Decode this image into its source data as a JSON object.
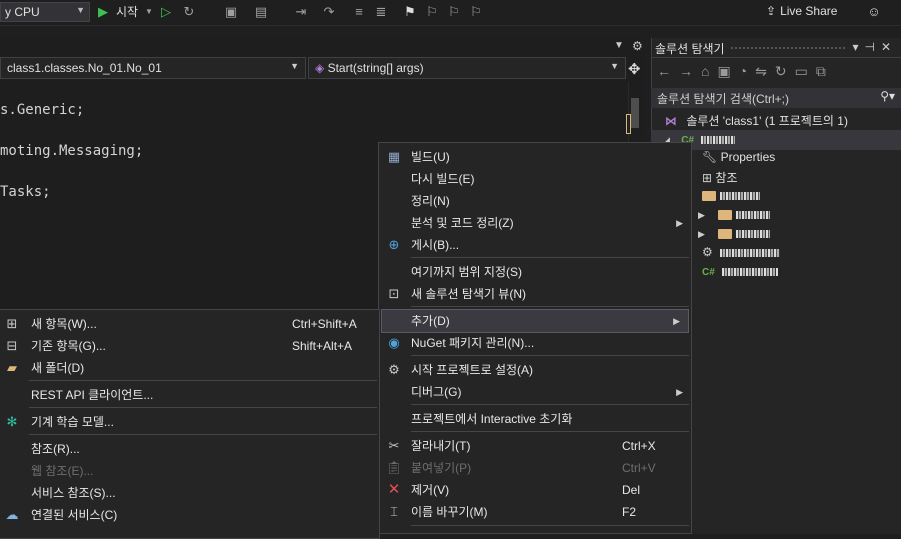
{
  "toolbar": {
    "platform": "y CPU",
    "start_label": "시작",
    "live_share_label": "Live Share"
  },
  "editor": {
    "nav_class": "class1.classes.No_01.No_01",
    "nav_member": "Start(string[] args)",
    "code_lines": [
      "s.Generic;",
      "moting.Messaging;",
      "Tasks;"
    ]
  },
  "solution_explorer": {
    "title": "솔루션 탐색기",
    "search_placeholder": "솔루션 탐색기 검색(Ctrl+;)",
    "solution_label": "솔루션 'class1' (1 프로젝트의 1)",
    "project_label": "class1",
    "items": [
      {
        "label": "Properties",
        "icon": "wrench-icon"
      },
      {
        "label": "참조",
        "icon": "references-icon"
      }
    ],
    "folder_labels": [
      "No_01",
      "No_02"
    ]
  },
  "project_menu": {
    "items": [
      {
        "label": "빌드(U)",
        "icon": "build-icon"
      },
      {
        "label": "다시 빌드(E)"
      },
      {
        "label": "정리(N)"
      },
      {
        "label": "분석 및 코드 정리(Z)",
        "submenu": true
      },
      {
        "label": "게시(B)...",
        "icon": "globe-icon"
      },
      {
        "label": "여기까지 범위 지정(S)"
      },
      {
        "label": "새 솔루션 탐색기 뷰(N)",
        "icon": "new-view-icon"
      },
      {
        "label": "추가(D)",
        "submenu": true,
        "highlighted": true
      },
      {
        "label": "NuGet 패키지 관리(N)...",
        "icon": "nuget-icon"
      },
      {
        "label": "시작 프로젝트로 설정(A)",
        "icon": "gear-icon"
      },
      {
        "label": "디버그(G)",
        "submenu": true
      },
      {
        "label": "프로젝트에서 Interactive 초기화"
      },
      {
        "label": "잘라내기(T)",
        "shortcut": "Ctrl+X",
        "icon": "scissors-icon"
      },
      {
        "label": "붙여넣기(P)",
        "shortcut": "Ctrl+V",
        "icon": "paste-icon",
        "disabled": true
      },
      {
        "label": "제거(V)",
        "shortcut": "Del",
        "icon": "remove-icon"
      },
      {
        "label": "이름 바꾸기(M)",
        "shortcut": "F2",
        "icon": "rename-icon"
      }
    ]
  },
  "add_menu": {
    "items": [
      {
        "label": "새 항목(W)...",
        "shortcut": "Ctrl+Shift+A",
        "icon": "new-item-icon"
      },
      {
        "label": "기존 항목(G)...",
        "shortcut": "Shift+Alt+A",
        "icon": "existing-item-icon"
      },
      {
        "label": "새 폴더(D)",
        "icon": "new-folder-icon"
      },
      {
        "label": "REST API 클라이언트..."
      },
      {
        "label": "기계 학습 모델...",
        "icon": "ml-model-icon"
      },
      {
        "label": "참조(R)..."
      },
      {
        "label": "웹 참조(E)...",
        "disabled": true
      },
      {
        "label": "서비스 참조(S)..."
      },
      {
        "label": "연결된 서비스(C)",
        "icon": "connected-service-icon"
      }
    ]
  },
  "colors": {
    "background": "#1f1f1f",
    "menu_bg": "#252526",
    "accent_green": "#3fbf4f",
    "folder": "#dcb67a"
  }
}
